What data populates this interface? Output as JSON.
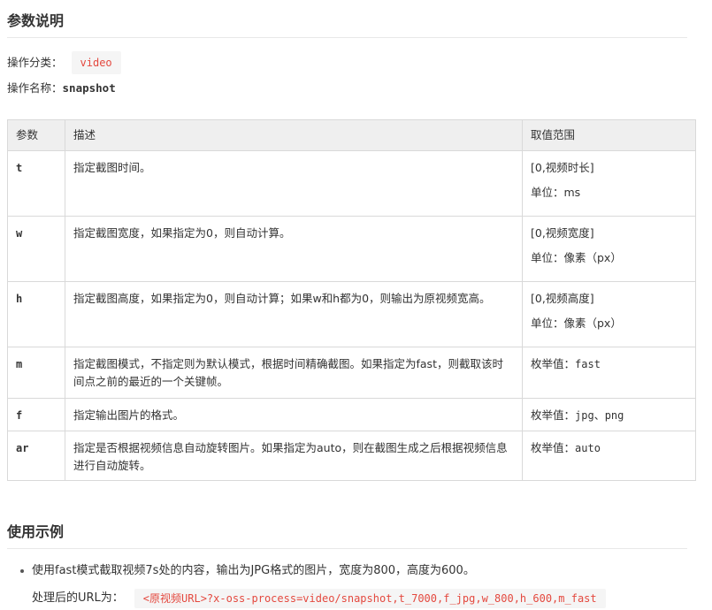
{
  "section1": {
    "title": "参数说明"
  },
  "meta": {
    "category_label": "操作分类：",
    "category_value": "video",
    "name_label": "操作名称：",
    "name_value": "snapshot"
  },
  "table": {
    "headers": [
      "参数",
      "描述",
      "取值范围"
    ],
    "rows": [
      {
        "param": "t",
        "desc": "指定截图时间。",
        "range": [
          "[0,视频时长]",
          "单位：ms"
        ]
      },
      {
        "param": "w",
        "desc": "指定截图宽度，如果指定为0，则自动计算。",
        "range": [
          "[0,视频宽度]",
          "单位：像素（px）"
        ]
      },
      {
        "param": "h",
        "desc": "指定截图高度，如果指定为0，则自动计算；如果w和h都为0，则输出为原视频宽高。",
        "range": [
          "[0,视频高度]",
          "单位：像素（px）"
        ]
      },
      {
        "param": "m",
        "desc": "指定截图模式，不指定则为默认模式，根据时间精确截图。如果指定为fast，则截取该时间点之前的最近的一个关键帧。",
        "range_label": "枚举值：",
        "range_value": "fast"
      },
      {
        "param": "f",
        "desc": "指定输出图片的格式。",
        "range_label": "枚举值：",
        "range_value": "jpg、png"
      },
      {
        "param": "ar",
        "desc": "指定是否根据视频信息自动旋转图片。如果指定为auto，则在截图生成之后根据视频信息进行自动旋转。",
        "range_label": "枚举值：",
        "range_value": "auto"
      }
    ]
  },
  "section2": {
    "title": "使用示例"
  },
  "example": {
    "text": "使用fast模式截取视频7s处的内容，输出为JPG格式的图片，宽度为800，高度为600。",
    "url_label": "处理后的URL为：",
    "url_value": "<原视频URL>?x-oss-process=video/snapshot,t_7000,f_jpg,w_800,h_600,m_fast"
  }
}
